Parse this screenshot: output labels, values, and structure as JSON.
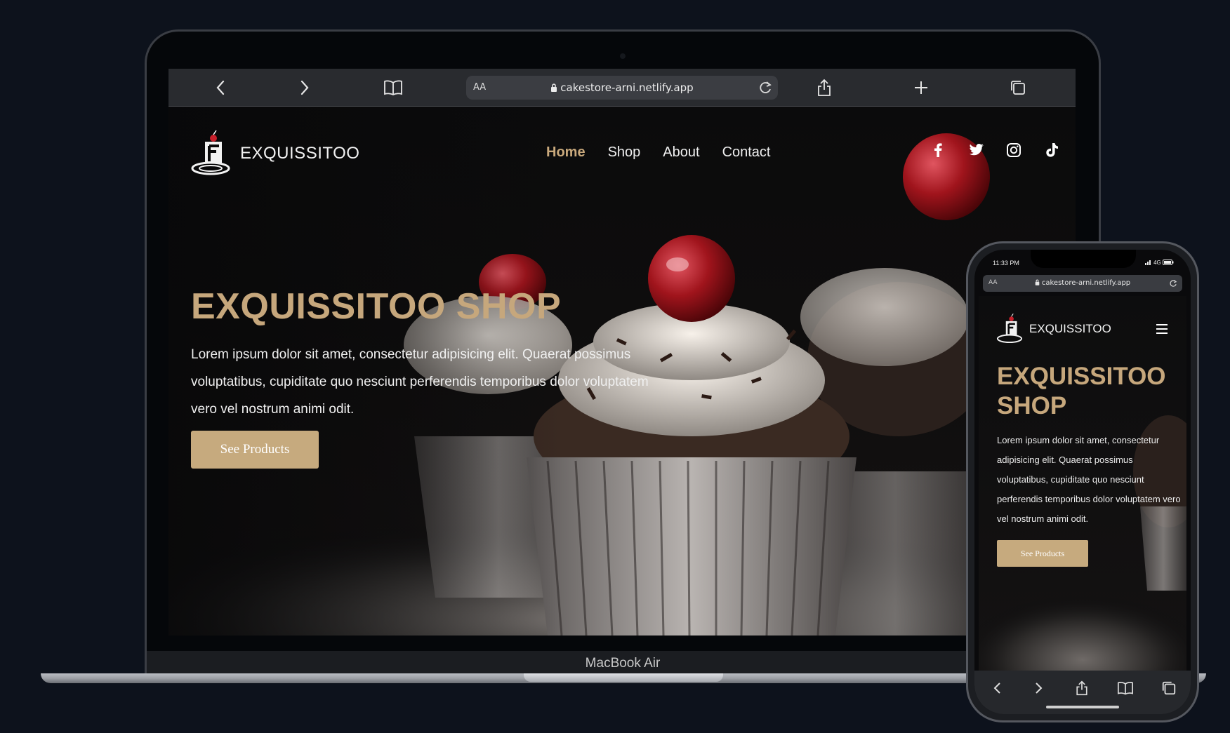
{
  "laptop": {
    "model_label": "MacBook Air",
    "safari": {
      "aa_label": "AA",
      "url": "cakestore-arni.netlify.app"
    },
    "site": {
      "brand": "EXQUISSITOO",
      "nav": [
        "Home",
        "Shop",
        "About",
        "Contact"
      ],
      "active_nav": "Home",
      "social_icons": [
        "facebook-icon",
        "twitter-icon",
        "instagram-icon",
        "tiktok-icon"
      ],
      "hero_title": "EXQUISSITOO SHOP",
      "hero_text": "Lorem ipsum dolor sit amet, consectetur adipisicing elit. Quaerat possimus voluptatibus, cupiditate quo nesciunt perferendis temporibus dolor voluptatem vero vel nostrum animi odit.",
      "cta_label": "See Products"
    }
  },
  "phone": {
    "status_time": "11:33 PM",
    "status_right": "4G",
    "safari": {
      "aa_label": "AA",
      "url": "cakestore-arni.netlify.app"
    },
    "site": {
      "brand": "EXQUISSITOO",
      "hero_title": "EXQUISSITOO SHOP",
      "hero_text": "Lorem ipsum dolor sit amet, consectetur adipisicing elit. Quaerat possimus voluptatibus, cupiditate quo nesciunt perferendis temporibus dolor voluptatem vero vel nostrum animi odit.",
      "cta_label": "See Products"
    }
  },
  "colors": {
    "background": "#0d121c",
    "accent_gold": "#c6a77c",
    "button_bg": "#c6aa7e",
    "safari_bar": "#292b2f"
  }
}
